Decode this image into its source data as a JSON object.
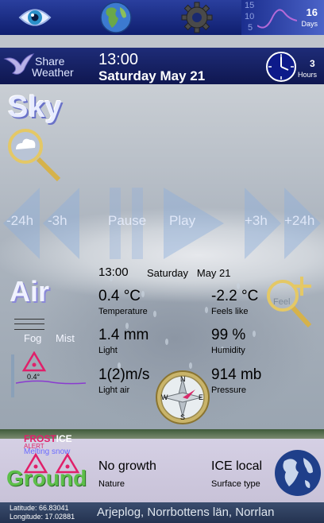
{
  "toolbar": {
    "forecast_scale": [
      "15",
      "10",
      "5"
    ],
    "forecast_days": "16",
    "forecast_days_label": "Days"
  },
  "header": {
    "share_line1": "Share",
    "share_line2": "Weather",
    "time": "13:00",
    "date": "Saturday  May 21",
    "hours_value": "3",
    "hours_label": "Hours"
  },
  "sky": {
    "title": "Sky",
    "controls": {
      "minus24": "-24h",
      "minus3": "-3h",
      "pause": "Pause",
      "play": "Play",
      "plus3": "+3h",
      "plus24": "+24h"
    }
  },
  "air": {
    "title": "Air",
    "time": "13:00",
    "date": "Saturday   May 21",
    "fog_label": "Fog",
    "mist_label": "Mist",
    "feels_badge": "Feel",
    "thermo_value": "0.4°",
    "temperature": {
      "value": "0.4 °C",
      "label": "Temperature"
    },
    "feels_like": {
      "value": "-2.2 °C",
      "label": "Feels like"
    },
    "precip": {
      "value": "1.4 mm",
      "label": "Light"
    },
    "humidity": {
      "value": "99 %",
      "label": "Humidity"
    },
    "wind": {
      "value": "1(2)m/s",
      "label": "Light air"
    },
    "pressure": {
      "value": "914 mb",
      "label": "Pressure"
    },
    "compass": {
      "n": "N",
      "e": "E",
      "s": "S",
      "w": "W"
    }
  },
  "ground": {
    "title": "Ground",
    "frost_label": "FROST",
    "ice_label": "ICE",
    "alert_label": "ALERT",
    "melting_label": "Melting snow",
    "nature": {
      "value": "No growth",
      "label": "Nature"
    },
    "surface": {
      "value": "ICE local",
      "label": "Surface type"
    }
  },
  "footer": {
    "latitude": "Latitude: 66.83041",
    "longitude": "Longitude: 17.02881",
    "location": "Arjeplog, Norrbottens län, Norrlan"
  },
  "colors": {
    "accent": "#1b2e8e",
    "alert": "#e0206a",
    "ground_green": "#5dbf4a"
  },
  "icons": [
    "eye-icon",
    "globe-icon",
    "gear-icon",
    "forecast-chart-icon",
    "share-bird-icon",
    "clock-icon",
    "magnifier-icon",
    "compass-icon",
    "warning-icon",
    "earth-icon"
  ]
}
